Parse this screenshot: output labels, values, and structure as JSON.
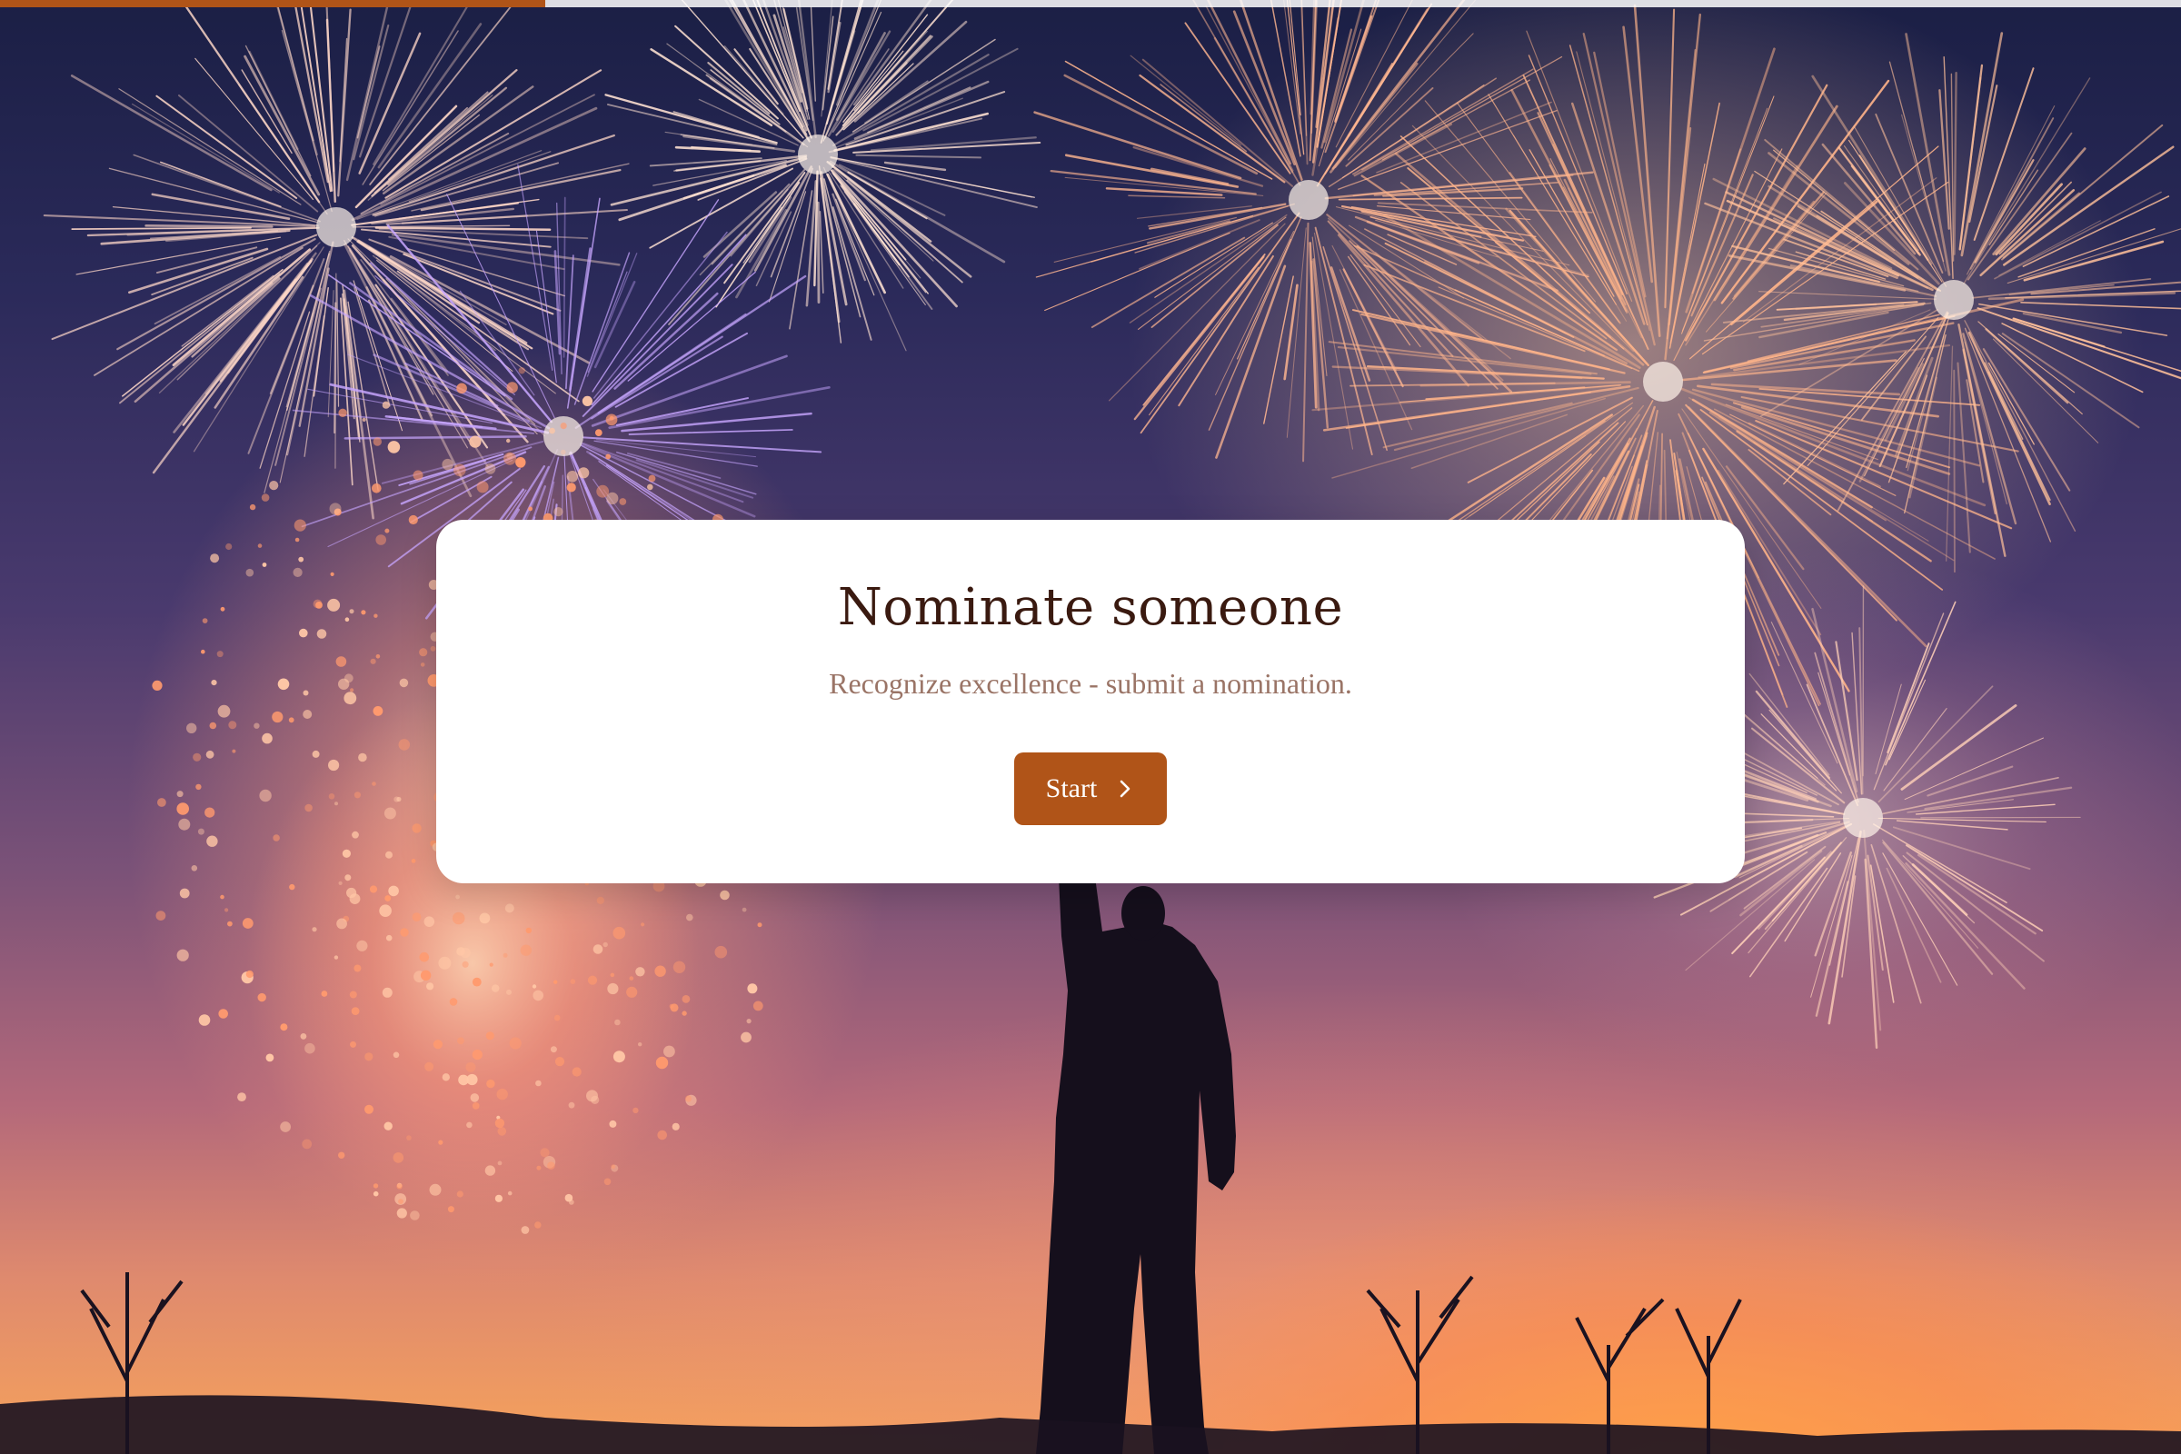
{
  "progress": {
    "fraction": 0.25,
    "fill_color": "#b05418"
  },
  "card": {
    "title": "Nominate someone",
    "subtitle": "Recognize excellence - submit a nomination.",
    "start_label": "Start",
    "start_icon": "chevron-right-icon"
  },
  "background": {
    "image": "night sky with fireworks and silhouette of person raising arm",
    "colors": {
      "sky_top": "#1b1f45",
      "sky_mid": "#7b5278",
      "horizon": "#f6a25b",
      "sparks": "#ffb48a"
    }
  },
  "colors": {
    "accent": "#b05418",
    "title": "#3a1a10",
    "subtitle": "#9a7466"
  }
}
